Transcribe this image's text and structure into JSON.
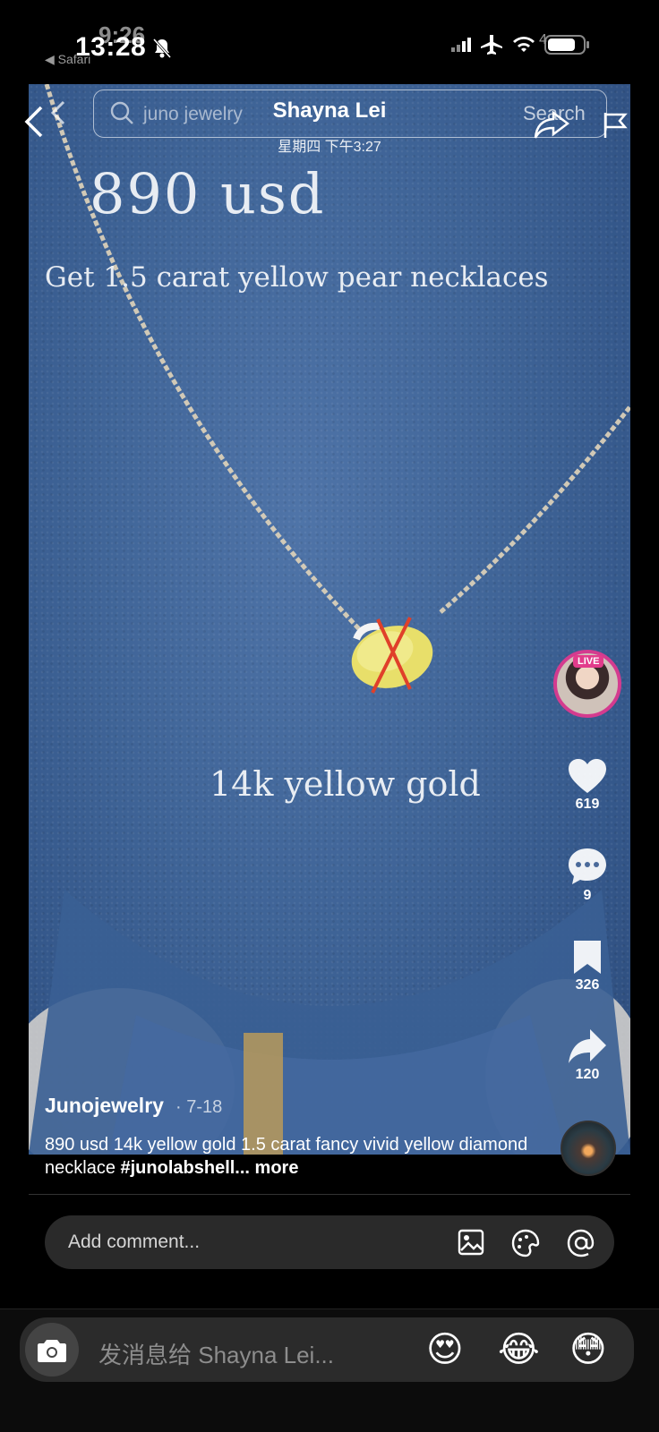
{
  "status_bar": {
    "time": "13:28",
    "time_ghost": "9:26",
    "back_app": "◀ Safari",
    "cellular": "4"
  },
  "header": {
    "search_placeholder": "juno jewelry",
    "search_button": "Search",
    "chat_name": "Shayna Lei",
    "chat_time": "星期四 下午3:27"
  },
  "video": {
    "price_text": "890  usd",
    "subtitle_text": "Get 1.5 carat yellow pear necklaces",
    "gold_text": "14k yellow gold"
  },
  "rail": {
    "live_label": "LIVE",
    "likes": "619",
    "comments": "9",
    "bookmarks": "326",
    "shares": "120"
  },
  "post": {
    "author": "Junojewelry",
    "date": "· 7-18",
    "caption_text": "890 usd 14k yellow gold 1.5 carat fancy vivid yellow diamond necklace ",
    "caption_tag": "#junolabshell...",
    "caption_more": " more"
  },
  "comment_bar": {
    "placeholder": "Add comment..."
  },
  "message_bar": {
    "placeholder": "发消息给 Shayna Lei...",
    "emoji_1": "😍",
    "emoji_2": "😂",
    "emoji_3": "😳"
  },
  "colors": {
    "live_ring": "#d43b8f",
    "video_blue": "#3f6497",
    "red_cross": "#e0402a"
  }
}
